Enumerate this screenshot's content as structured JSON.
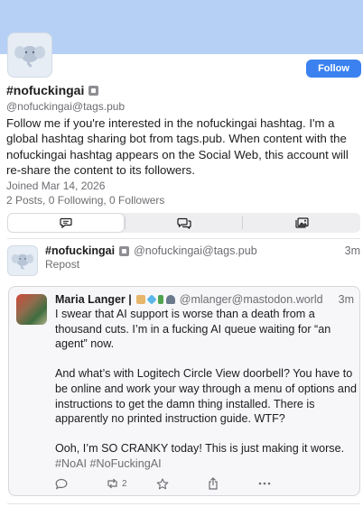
{
  "profile": {
    "display_name": "#nofuckingai",
    "handle": "@nofuckingai@tags.pub",
    "bio": "Follow me if you're interested in the nofuckingai hashtag.  I'm a global hashtag sharing bot from tags.pub. When content  with the nofuckingai hashtag appears on the Social Web,  this account will re-share the content to its followers.",
    "joined": "Joined Mar 14, 2026",
    "stats": "2 Posts, 0 Following, 0 Followers",
    "follow_label": "Follow"
  },
  "tabs": [
    {
      "icon": "speech-bubble-icon",
      "active": true
    },
    {
      "icon": "double-speech-bubble-icon",
      "active": false
    },
    {
      "icon": "image-gallery-icon",
      "active": false
    }
  ],
  "post": {
    "name": "#nofuckingai",
    "handle": "@nofuckingai@tags.pub",
    "time": "3m",
    "repost_label": "Repost",
    "quote": {
      "name": "Maria Langer |",
      "handle": "@mlanger@mastodon.world",
      "time": "3m",
      "paragraphs": [
        "I swear that AI support is worse than a death from a thousand cuts. I’m in a fucking AI queue waiting for “an agent” now.",
        "And what’s with Logitech Circle View doorbell? You have to be online and work your way through a menu of options and instructions to get the damn thing installed. There is apparently no printed instruction guide. WTF?",
        "Ooh, I’m SO CRANKY today! This is just making it worse."
      ],
      "hashtags": "#NoAI #NoFuckingAI"
    },
    "actions": {
      "reply_count": "",
      "boost_count": "2"
    }
  },
  "colors": {
    "banner": "#b6d0f5",
    "accent": "#3b82f0",
    "muted_text": "#6d6d72"
  }
}
